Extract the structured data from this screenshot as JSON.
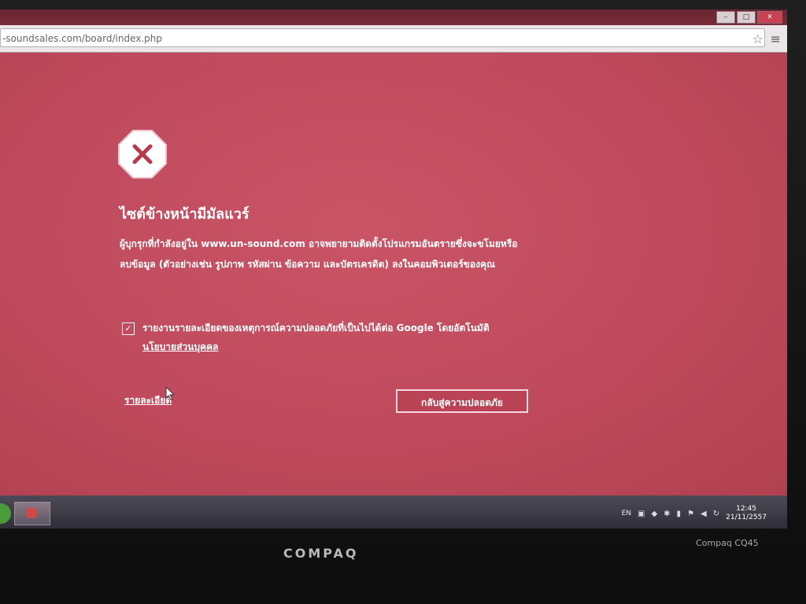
{
  "browser": {
    "url": "-soundsales.com/board/index.php",
    "window_buttons": [
      "–",
      "□",
      "✕"
    ]
  },
  "page": {
    "headline": "ไซต์ข้างหน้ามีมัลแวร์",
    "body": "ผู้บุกรุกที่กำลังอยู่ใน www.un-sound.com อาจพยายามติดตั้งโปรแกรมอันตรายซึ่งจะขโมยหรือลบข้อมูล (ตัวอย่างเช่น รูปภาพ รหัสผ่าน ข้อความ และบัตรเครดิต) ลงในคอมพิวเตอร์ของคุณ",
    "report_text": "รายงานรายละเอียดของเหตุการณ์ความปลอดภัยที่เป็นไปได้ต่อ Google โดยอัตโนมัติ",
    "privacy_link": "นโยบายส่วนบุคคล",
    "details_link": "รายละเอียด",
    "back_button": "กลับสู่ความปลอดภัย"
  },
  "taskbar": {
    "language": "EN",
    "time": "12:45",
    "date": "21/11/2557"
  },
  "bezel": {
    "brand": "COMPAQ",
    "model": "Compaq CQ45"
  }
}
